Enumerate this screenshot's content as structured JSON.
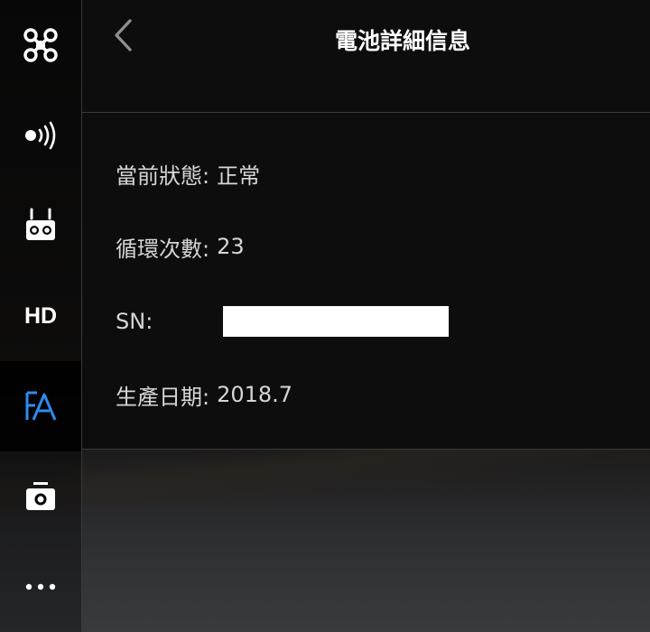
{
  "sidebar": {
    "items": [
      {
        "id": "aircraft",
        "icon": "drone-icon"
      },
      {
        "id": "signal",
        "icon": "signal-broadcast-icon"
      },
      {
        "id": "remote",
        "icon": "remote-controller-icon"
      },
      {
        "id": "hd",
        "label": "HD"
      },
      {
        "id": "battery",
        "icon": "battery-flight-icon",
        "active": true
      },
      {
        "id": "camera",
        "icon": "camera-icon"
      },
      {
        "id": "more",
        "icon": "more-dots-icon"
      }
    ]
  },
  "header": {
    "title": "電池詳細信息",
    "back_icon": "chevron-left-icon"
  },
  "info": {
    "status_label": "當前狀態:",
    "status_value": "正常",
    "cycles_label": "循環次數:",
    "cycles_value": "23",
    "sn_label": "SN:",
    "production_label": "生產日期:",
    "production_value": "2018.7"
  },
  "colors": {
    "accent": "#2e8cf0",
    "text": "#d6d6d6",
    "title": "#ffffff",
    "divider": "#3a3a3a"
  }
}
